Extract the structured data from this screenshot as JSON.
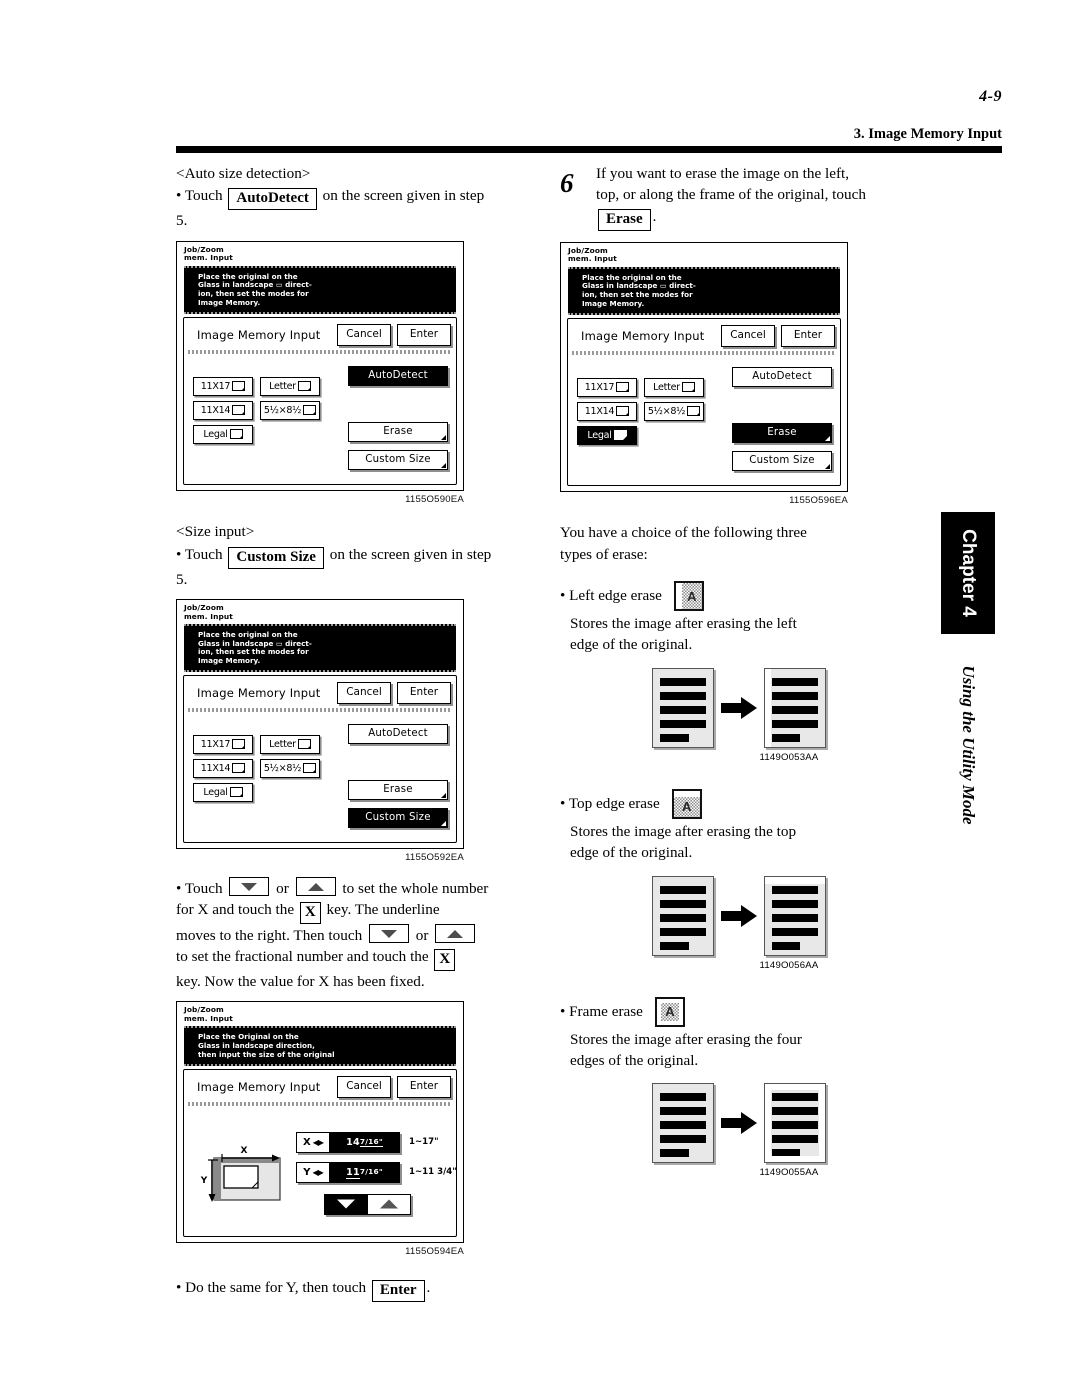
{
  "header": {
    "page_number": "4-9",
    "section_title": "3. Image Memory Input"
  },
  "chapter_tab": {
    "label": "Chapter 4",
    "subtitle": "Using the Utility Mode"
  },
  "left_column": {
    "auto_size": {
      "heading": "<Auto size detection>",
      "bullet_prefix": "• Touch",
      "key": "AutoDetect",
      "bullet_suffix": "on the screen given in step",
      "bullet_tail": "5."
    },
    "panel1": {
      "title_line1": "Job/Zoom",
      "title_line2": "mem. Input",
      "message": "Place the original on the Glass in landscape ▭ direct-ion, then set the modes for Image Memory.",
      "message_lines": [
        "Place the original on the",
        "Glass in landscape ▭ direct-",
        "ion, then set the modes for",
        "Image Memory."
      ],
      "screen_label": "Image Memory Input",
      "cancel": "Cancel",
      "enter": "Enter",
      "autodetect": "AutoDetect",
      "erase": "Erase",
      "custom_size": "Custom Size",
      "sizes": [
        "11X17",
        "Letter",
        "11X14",
        "5½×8½",
        "Legal"
      ],
      "selected": "AutoDetect",
      "caption": "1155O590EA"
    },
    "size_input": {
      "heading": "<Size input>",
      "bullet_prefix": "• Touch",
      "key": "Custom Size",
      "bullet_suffix": "on the screen given in step",
      "bullet_tail": "5."
    },
    "panel2": {
      "title_line1": "Job/Zoom",
      "title_line2": "mem. Input",
      "message_lines": [
        "Place the original on the",
        "Glass in landscape ▭ direct-",
        "ion, then set the modes for",
        "Image Memory."
      ],
      "screen_label": "Image Memory Input",
      "cancel": "Cancel",
      "enter": "Enter",
      "autodetect": "AutoDetect",
      "erase": "Erase",
      "custom_size": "Custom Size",
      "sizes": [
        "11X17",
        "Letter",
        "11X14",
        "5½×8½",
        "Legal"
      ],
      "selected": "Custom Size",
      "caption": "1155O592EA"
    },
    "touch_instruction": {
      "p1": "• Touch",
      "p2": "or",
      "p3": "to set the whole number",
      "p4": "for X and touch the",
      "key_x1": "X",
      "p5": "key. The underline",
      "p6": "moves to the right. Then touch",
      "p7": "or",
      "p8": "to set the fractional number and touch the",
      "key_x2": "X",
      "p9": "key. Now the value for X has been fixed."
    },
    "panel3": {
      "title_line1": "Job/Zoom",
      "title_line2": "mem. Input",
      "message_lines": [
        "Place the Original on the",
        "Glass in landscape direction,",
        "then input the size of the original"
      ],
      "screen_label": "Image Memory Input",
      "cancel": "Cancel",
      "enter": "Enter",
      "x_tag": "X",
      "x_whole": "14",
      "x_frac": "7/16\"",
      "x_range": "1~17\"",
      "y_tag": "Y",
      "y_whole": "11",
      "y_frac": "7/16\"",
      "y_range": "1~11 3/4\"",
      "diagram_x_label": "X",
      "diagram_y_label": "Y",
      "caption": "1155O594EA"
    },
    "final_instruction": {
      "prefix": "• Do the same for Y, then touch",
      "key": "Enter",
      "suffix": "."
    }
  },
  "right_column": {
    "step": {
      "number": "6",
      "line1": "If you want to erase the image on the left,",
      "line2": "top, or along the frame of the original, touch",
      "key": "Erase",
      "suffix": "."
    },
    "panel4": {
      "title_line1": "Job/Zoom",
      "title_line2": "mem. Input",
      "message_lines": [
        "Place the original on the",
        "Glass in landscape ▭ direct-",
        "ion, then set the modes for",
        "Image Memory."
      ],
      "screen_label": "Image Memory Input",
      "cancel": "Cancel",
      "enter": "Enter",
      "autodetect": "AutoDetect",
      "erase": "Erase",
      "custom_size": "Custom Size",
      "sizes": [
        "11X17",
        "Letter",
        "11X14",
        "5½×8½",
        "Legal"
      ],
      "selected": "Erase",
      "caption": "1155O596EA"
    },
    "choice_text": {
      "line1": "You have a choice of the following three",
      "line2": "types of erase:"
    },
    "erase_types": [
      {
        "label": "• Left edge erase",
        "icon_letter": "A",
        "icon_name": "left-edge-erase-icon",
        "description_line1": "Stores the image after erasing the left",
        "description_line2": "edge of the original.",
        "caption": "1149O053AA"
      },
      {
        "label": "• Top edge erase",
        "icon_letter": "A",
        "icon_name": "top-edge-erase-icon",
        "description_line1": "Stores the image after erasing the top",
        "description_line2": "edge of the original.",
        "caption": "1149O056AA"
      },
      {
        "label": "• Frame erase",
        "icon_letter": "A",
        "icon_name": "frame-erase-icon",
        "description_line1": "Stores the image after erasing the four",
        "description_line2": "edges of the original.",
        "caption": "1149O055AA"
      }
    ]
  }
}
